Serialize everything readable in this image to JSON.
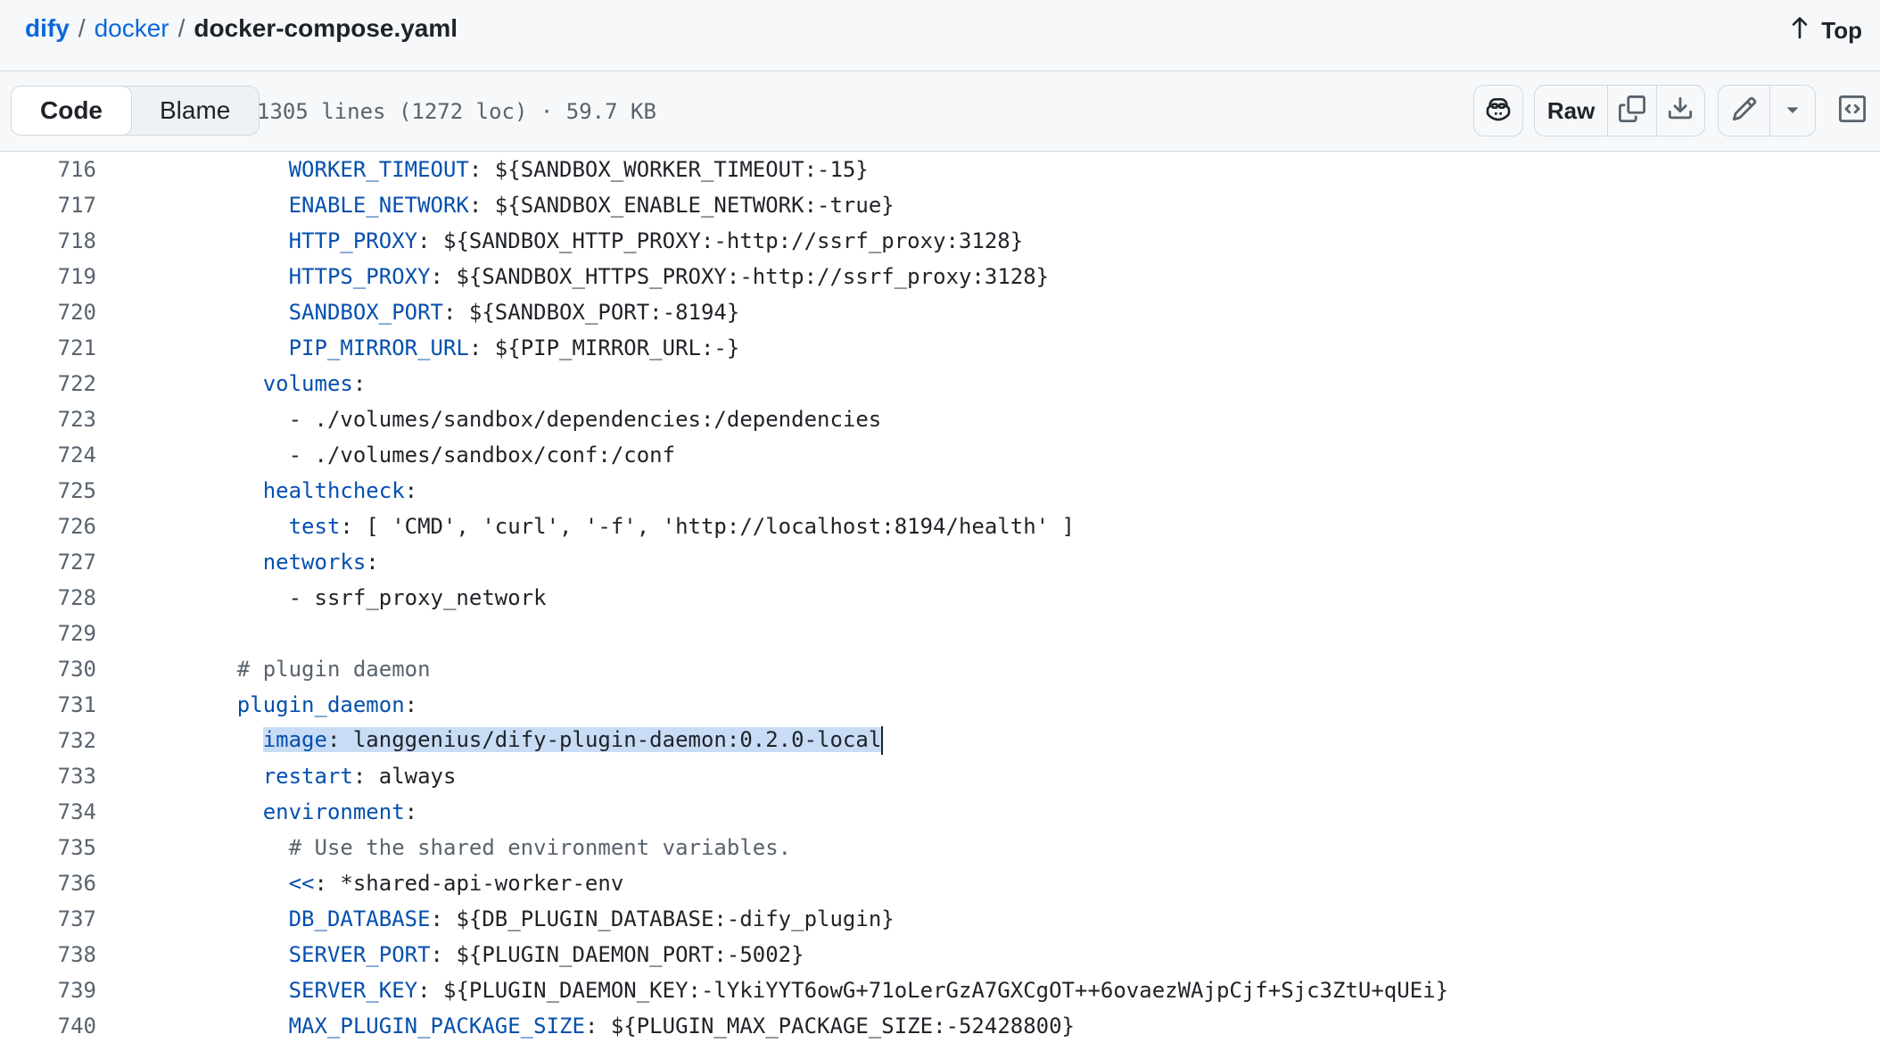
{
  "breadcrumb": {
    "repo": "dify",
    "folder": "docker",
    "file": "docker-compose.yaml",
    "separator": "/"
  },
  "top_link": {
    "label": "Top"
  },
  "toolbar": {
    "tab_code": "Code",
    "tab_blame": "Blame",
    "active_tab": "Code",
    "file_info": "1305 lines (1272 loc) · 59.7 KB",
    "raw_label": "Raw",
    "icons": [
      "copilot-icon",
      "copy-icon",
      "download-icon",
      "pencil-icon",
      "triangle-down-icon",
      "code-panel-icon"
    ]
  },
  "colors": {
    "link": "#0969da",
    "yaml_key": "#0550ae",
    "comment": "#59636e",
    "selection": "#c9dcf6"
  },
  "code": {
    "selected_line": "732",
    "lines": [
      {
        "num": "716",
        "indent": "    ",
        "key": "WORKER_TIMEOUT",
        "rest": ": ${SANDBOX_WORKER_TIMEOUT:-15}"
      },
      {
        "num": "717",
        "indent": "    ",
        "key": "ENABLE_NETWORK",
        "rest": ": ${SANDBOX_ENABLE_NETWORK:-true}"
      },
      {
        "num": "718",
        "indent": "    ",
        "key": "HTTP_PROXY",
        "rest": ": ${SANDBOX_HTTP_PROXY:-http://ssrf_proxy:3128}"
      },
      {
        "num": "719",
        "indent": "    ",
        "key": "HTTPS_PROXY",
        "rest": ": ${SANDBOX_HTTPS_PROXY:-http://ssrf_proxy:3128}"
      },
      {
        "num": "720",
        "indent": "    ",
        "key": "SANDBOX_PORT",
        "rest": ": ${SANDBOX_PORT:-8194}"
      },
      {
        "num": "721",
        "indent": "    ",
        "key": "PIP_MIRROR_URL",
        "rest": ": ${PIP_MIRROR_URL:-}"
      },
      {
        "num": "722",
        "indent": "  ",
        "key": "volumes",
        "rest": ":"
      },
      {
        "num": "723",
        "indent": "    ",
        "key": "",
        "rest": "- ./volumes/sandbox/dependencies:/dependencies"
      },
      {
        "num": "724",
        "indent": "    ",
        "key": "",
        "rest": "- ./volumes/sandbox/conf:/conf"
      },
      {
        "num": "725",
        "indent": "  ",
        "key": "healthcheck",
        "rest": ":"
      },
      {
        "num": "726",
        "indent": "    ",
        "key": "test",
        "rest": ": [ 'CMD', 'curl', '-f', 'http://localhost:8194/health' ]"
      },
      {
        "num": "727",
        "indent": "  ",
        "key": "networks",
        "rest": ":"
      },
      {
        "num": "728",
        "indent": "    ",
        "key": "",
        "rest": "- ssrf_proxy_network"
      },
      {
        "num": "729",
        "indent": "",
        "key": "",
        "rest": ""
      },
      {
        "num": "730",
        "indent": "",
        "key": "",
        "rest": "",
        "comment": "# plugin daemon"
      },
      {
        "num": "731",
        "indent": "",
        "key": "plugin_daemon",
        "rest": ":"
      },
      {
        "num": "732",
        "indent": "  ",
        "key": "image",
        "rest": ": langgenius/dify-plugin-daemon:0.2.0-local",
        "selected": true
      },
      {
        "num": "733",
        "indent": "  ",
        "key": "restart",
        "rest": ": always"
      },
      {
        "num": "734",
        "indent": "  ",
        "key": "environment",
        "rest": ":"
      },
      {
        "num": "735",
        "indent": "    ",
        "key": "",
        "rest": "",
        "comment": "# Use the shared environment variables."
      },
      {
        "num": "736",
        "indent": "    ",
        "key": "<<",
        "rest": ": *shared-api-worker-env"
      },
      {
        "num": "737",
        "indent": "    ",
        "key": "DB_DATABASE",
        "rest": ": ${DB_PLUGIN_DATABASE:-dify_plugin}"
      },
      {
        "num": "738",
        "indent": "    ",
        "key": "SERVER_PORT",
        "rest": ": ${PLUGIN_DAEMON_PORT:-5002}"
      },
      {
        "num": "739",
        "indent": "    ",
        "key": "SERVER_KEY",
        "rest": ": ${PLUGIN_DAEMON_KEY:-lYkiYYT6owG+71oLerGzA7GXCgOT++6ovaezWAjpCjf+Sjc3ZtU+qUEi}"
      },
      {
        "num": "740",
        "indent": "    ",
        "key": "MAX_PLUGIN_PACKAGE_SIZE",
        "rest": ": ${PLUGIN_MAX_PACKAGE_SIZE:-52428800}"
      }
    ]
  }
}
